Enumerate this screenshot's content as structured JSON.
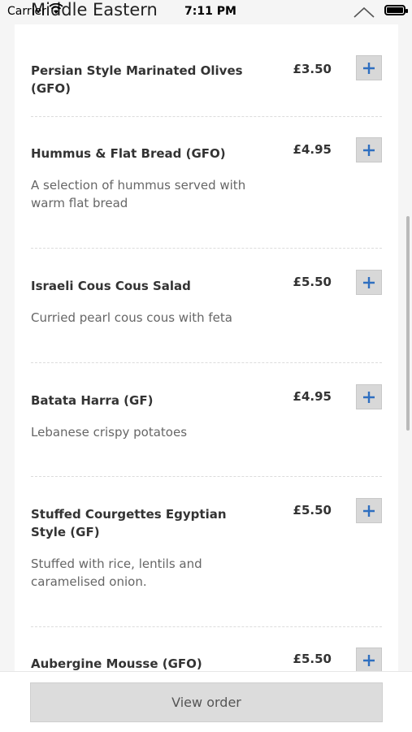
{
  "status": {
    "carrier": "Carrier",
    "time": "7:11 PM"
  },
  "header": {
    "title": "Middle Eastern"
  },
  "items": [
    {
      "name": "Persian Style Marinated Olives (GFO)",
      "desc": "",
      "price": "£3.50"
    },
    {
      "name": "Hummus & Flat Bread (GFO)",
      "desc": "A selection of hummus served with warm flat bread",
      "price": "£4.95"
    },
    {
      "name": "Israeli Cous Cous Salad",
      "desc": "Curried pearl cous cous with feta",
      "price": "£5.50"
    },
    {
      "name": "Batata Harra (GF)",
      "desc": "Lebanese crispy potatoes",
      "price": "£4.95"
    },
    {
      "name": "Stuffed Courgettes Egyptian Style (GF)",
      "desc": "Stuffed with rice, lentils and caramelised onion.",
      "price": "£5.50"
    },
    {
      "name": "Aubergine Mousse (GFO)",
      "desc": "",
      "price": "£5.50"
    }
  ],
  "footer": {
    "view_order_label": "View order"
  },
  "colors": {
    "accent": "#2f6fc0",
    "button_bg": "#d8d8d8"
  }
}
